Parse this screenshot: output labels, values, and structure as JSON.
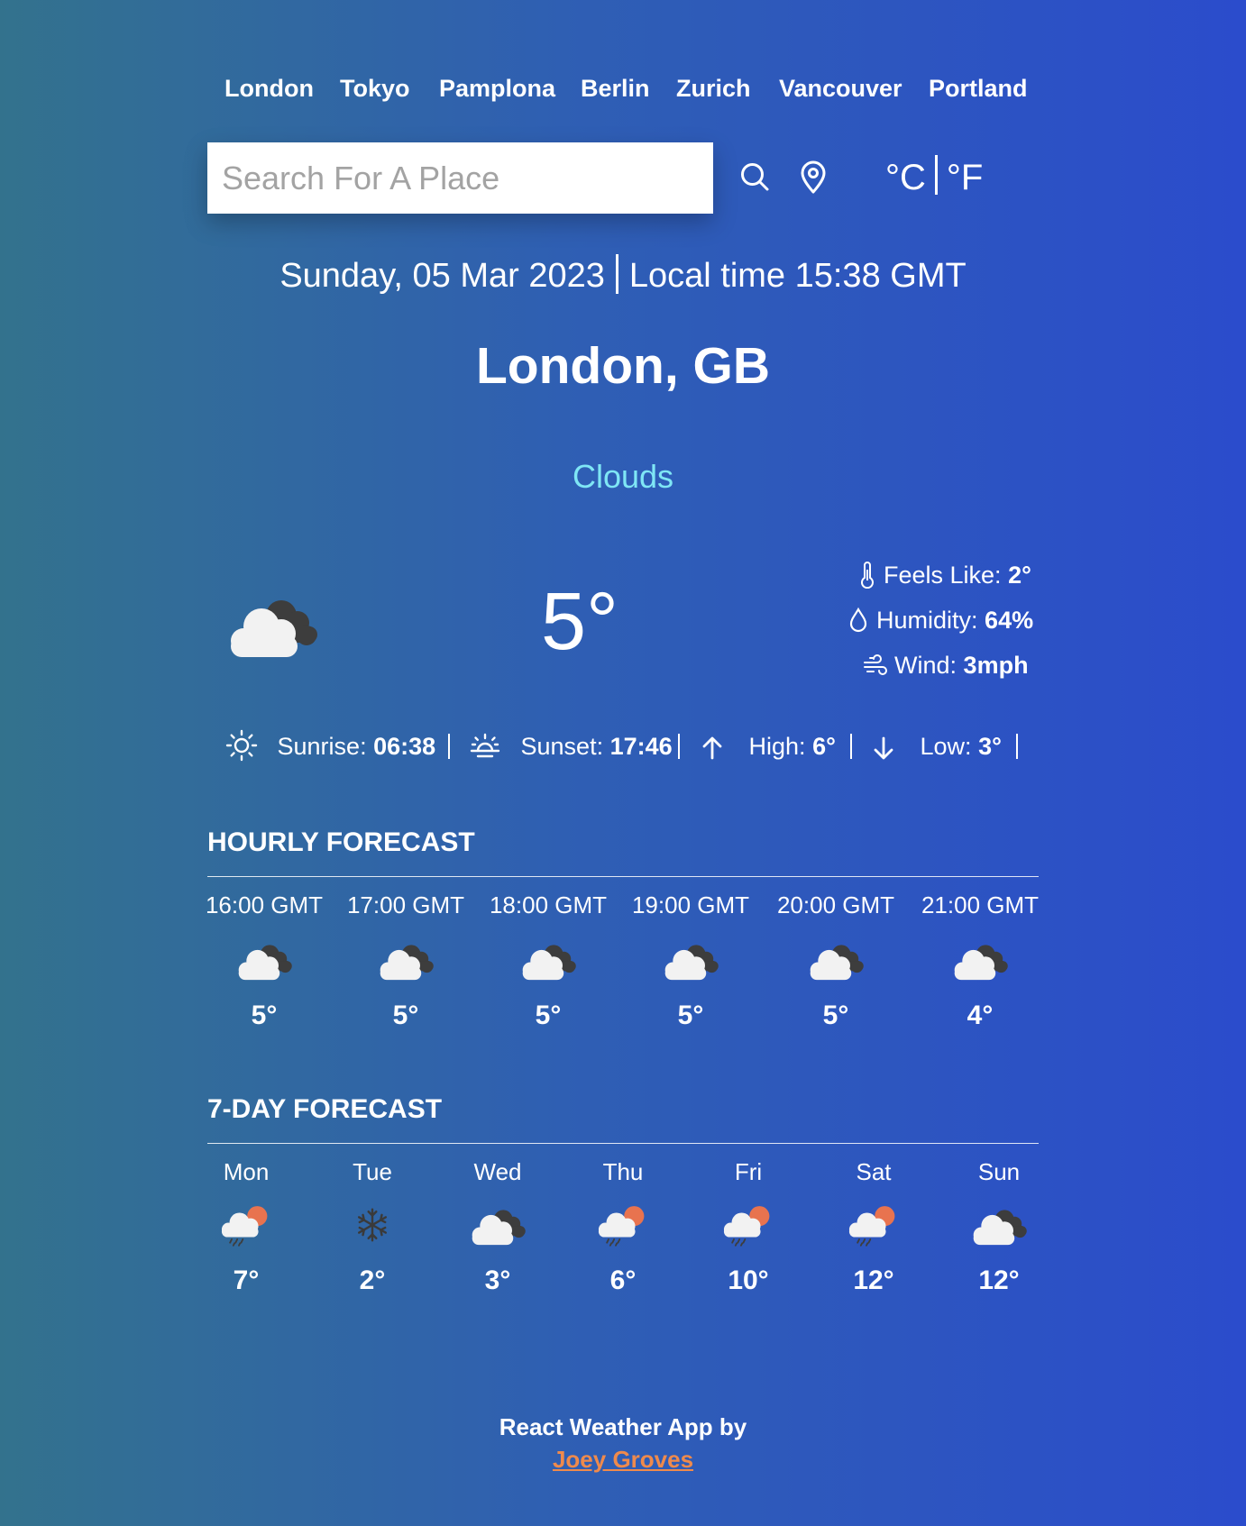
{
  "nav": {
    "cities": [
      "London",
      "Tokyo",
      "Pamplona",
      "Berlin",
      "Zurich",
      "Vancouver",
      "Portland"
    ]
  },
  "search": {
    "placeholder": "Search For A Place",
    "value": "",
    "search_icon": "search-icon",
    "location_icon": "location-pin-icon"
  },
  "units": {
    "celsius": "°C",
    "fahrenheit": "°F"
  },
  "datetime": {
    "date": "Sunday, 05 Mar 2023",
    "local_time": "Local time 15:38 GMT"
  },
  "location": "London, GB",
  "current": {
    "condition": "Clouds",
    "temperature": "5°",
    "icon": "cloudy-icon",
    "feels_like_label": "Feels Like:",
    "feels_like": "2°",
    "humidity_label": "Humidity:",
    "humidity": "64%",
    "wind_label": "Wind:",
    "wind": "3mph"
  },
  "sun": {
    "sunrise_label": "Sunrise:",
    "sunrise": "06:38",
    "sunset_label": "Sunset:",
    "sunset": "17:46",
    "high_label": "High:",
    "high": "6°",
    "low_label": "Low:",
    "low": "3°"
  },
  "hourly": {
    "title": "HOURLY FORECAST",
    "items": [
      {
        "time": "16:00 GMT",
        "icon": "cloudy-icon",
        "temp": "5°"
      },
      {
        "time": "17:00 GMT",
        "icon": "cloudy-icon",
        "temp": "5°"
      },
      {
        "time": "18:00 GMT",
        "icon": "cloudy-icon",
        "temp": "5°"
      },
      {
        "time": "19:00 GMT",
        "icon": "cloudy-icon",
        "temp": "5°"
      },
      {
        "time": "20:00 GMT",
        "icon": "cloudy-icon",
        "temp": "5°"
      },
      {
        "time": "21:00 GMT",
        "icon": "cloudy-icon",
        "temp": "4°"
      }
    ]
  },
  "daily": {
    "title": "7-DAY FORECAST",
    "items": [
      {
        "day": "Mon",
        "icon": "sun-rain-icon",
        "temp": "7°"
      },
      {
        "day": "Tue",
        "icon": "snowflake-icon",
        "temp": "2°"
      },
      {
        "day": "Wed",
        "icon": "cloudy-icon",
        "temp": "3°"
      },
      {
        "day": "Thu",
        "icon": "sun-rain-icon",
        "temp": "6°"
      },
      {
        "day": "Fri",
        "icon": "sun-rain-icon",
        "temp": "10°"
      },
      {
        "day": "Sat",
        "icon": "sun-rain-icon",
        "temp": "12°"
      },
      {
        "day": "Sun",
        "icon": "cloudy-icon",
        "temp": "12°"
      }
    ]
  },
  "footer": {
    "text": "React Weather App by",
    "author": "Joey Groves"
  },
  "colors": {
    "condition": "#7fe6f5",
    "link": "#ef8a4c",
    "gradient_left": "#33728d",
    "gradient_right": "#2b4ccc"
  }
}
